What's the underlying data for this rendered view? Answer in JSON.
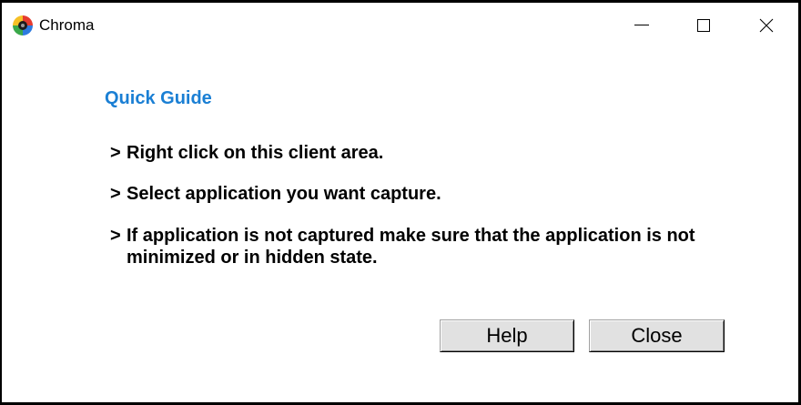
{
  "window": {
    "title": "Chroma"
  },
  "icons": {
    "app": "chroma-app-icon",
    "minimize": "minimize-icon",
    "maximize": "maximize-icon",
    "close": "close-icon"
  },
  "guide": {
    "heading": "Quick Guide",
    "items": [
      {
        "marker": ">",
        "text": "Right click on this client area."
      },
      {
        "marker": ">",
        "text": "Select application you want capture."
      },
      {
        "marker": ">",
        "text": "If application is not captured make sure that the application is not minimized or in hidden state."
      }
    ]
  },
  "buttons": {
    "help": "Help",
    "close": "Close"
  },
  "colors": {
    "window_background": "#ffffff",
    "window_border": "#000000",
    "heading": "#1a7fd4",
    "text": "#000000",
    "button_face": "#e1e1e1"
  }
}
